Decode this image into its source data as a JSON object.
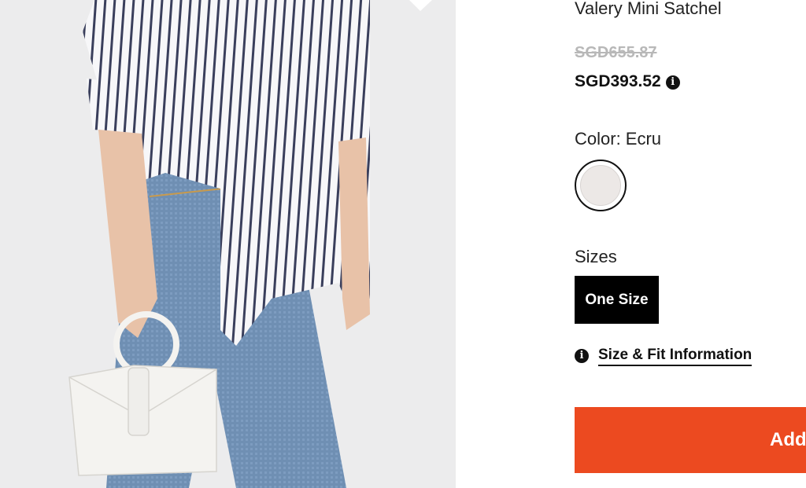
{
  "product": {
    "name": "Valery Mini Satchel",
    "original_price": "SGD655.87",
    "sale_price": "SGD393.52",
    "price_info_icon": "info-icon"
  },
  "color": {
    "label": "Color: Ecru",
    "swatch_color": "#ece8e6"
  },
  "sizes": {
    "label": "Sizes",
    "options": [
      "One Size"
    ],
    "selected": "One Size"
  },
  "size_fit": {
    "icon": "info-icon",
    "link_text": "Size & Fit Information"
  },
  "cart": {
    "button_label": "Add",
    "accent_color": "#ec4a20"
  }
}
